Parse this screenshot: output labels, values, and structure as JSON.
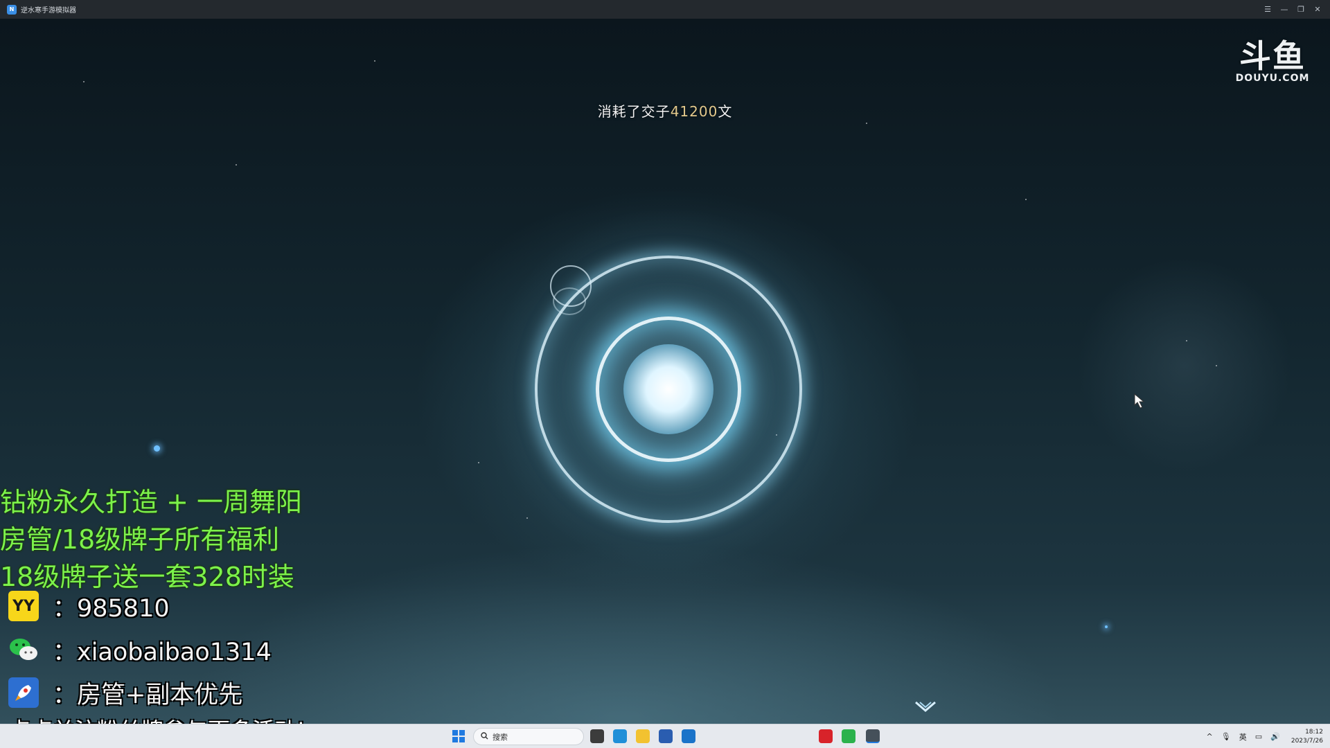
{
  "window": {
    "title": "逆水寒手游模拟器",
    "app_icon_text": "N",
    "controls": {
      "menu": "☰",
      "minimize": "—",
      "restore": "❐",
      "close": "✕"
    }
  },
  "game": {
    "consume_prefix": "消耗了交子",
    "consume_amount": "41200",
    "consume_suffix": "文"
  },
  "logo": {
    "glyph": "斗鱼",
    "text": "DOUYU.COM"
  },
  "overlay": {
    "promo_lines": [
      "钻粉永久打造 + 一周舞阳",
      "房管/18级牌子所有福利",
      "18级牌子送一套328时装"
    ],
    "contacts": [
      {
        "icon": "yy-icon",
        "icon_text": "YY",
        "text": "：985810"
      },
      {
        "icon": "wechat-icon",
        "text": "：xiaobaibao1314"
      },
      {
        "icon": "rocket-icon",
        "text": "：房管+副本优先"
      }
    ],
    "follow_banner": "点点关注粉丝牌参与更多活动!"
  },
  "taskbar": {
    "search_placeholder": "搜索",
    "apps": [
      {
        "name": "task-view",
        "color": "#3c3c3c"
      },
      {
        "name": "edge",
        "color": "#1f8fd8"
      },
      {
        "name": "file-explorer",
        "color": "#f2c230"
      },
      {
        "name": "store",
        "color": "#2a5db0"
      },
      {
        "name": "mail",
        "color": "#1a73c9"
      },
      {
        "name": "app-green",
        "color": "#38b24a"
      },
      {
        "name": "app-glasses",
        "color": "#e59a1c"
      },
      {
        "name": "app-blue",
        "color": "#2d9be0"
      },
      {
        "name": "app-red-orange",
        "color": "#e85a2a"
      },
      {
        "name": "app-figure",
        "color": "#55606b"
      },
      {
        "name": "netease-music",
        "color": "#d8232a"
      },
      {
        "name": "wechat",
        "color": "#2bb24c"
      },
      {
        "name": "game-active",
        "color": "#45505a"
      }
    ],
    "tray": {
      "caret": "^",
      "mic": "🎙",
      "ime": "英",
      "net": "▭",
      "volume": "🔊"
    },
    "time": "18:12",
    "date": "2023/7/26"
  }
}
